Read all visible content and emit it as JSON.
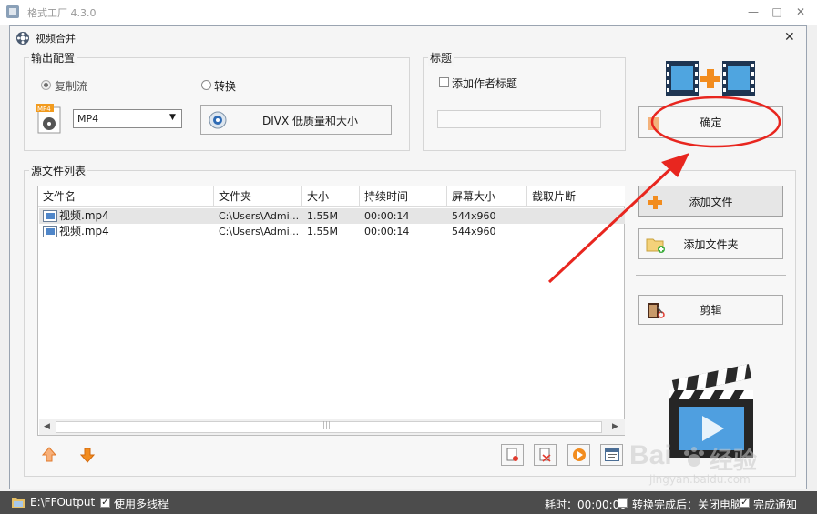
{
  "app": {
    "title": "格式工厂 4.3.0"
  },
  "dialog": {
    "title": "视频合并"
  },
  "output_config": {
    "label": "输出配置",
    "mode_copy": "复制流",
    "mode_convert": "转换",
    "format_selected": "MP4",
    "preset_label": "DIVX 低质量和大小"
  },
  "title_group": {
    "label": "标题",
    "add_author_title": "添加作者标题",
    "title_input_value": ""
  },
  "actions": {
    "confirm": "确定",
    "add_file": "添加文件",
    "add_folder": "添加文件夹",
    "edit": "剪辑"
  },
  "source_list": {
    "label": "源文件列表",
    "columns": [
      "文件名",
      "文件夹",
      "大小",
      "持续时间",
      "屏幕大小",
      "截取片断"
    ],
    "rows": [
      [
        "视频.mp4",
        "C:\\Users\\Admi...",
        "1.55M",
        "00:00:14",
        "544x960",
        ""
      ],
      [
        "视频.mp4",
        "C:\\Users\\Admi...",
        "1.55M",
        "00:00:14",
        "544x960",
        ""
      ]
    ]
  },
  "watermark": {
    "brand": "Bai",
    "brand2": "经验",
    "url": "jingyan.baidu.com"
  },
  "status": {
    "output_path": "E:\\FFOutput",
    "multithread": "使用多线程",
    "elapsed": "耗时：00:00:00",
    "shutdown_after": "转换完成后：关闭电脑",
    "notify": "完成通知"
  },
  "colors": {
    "annotation_red": "#e8261f",
    "accent_orange": "#f28c1e"
  }
}
